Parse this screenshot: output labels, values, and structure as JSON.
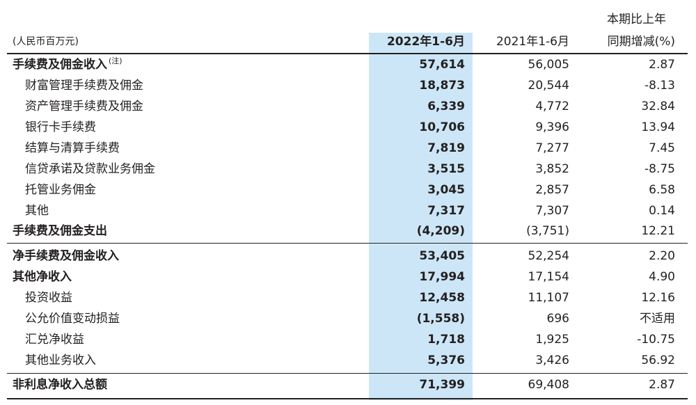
{
  "header": {
    "unit": "(人民币百万元)",
    "col1": "2022年1-6月",
    "col2": "2021年1-6月",
    "col3_line1": "本期比上年",
    "col3_line2": "同期增减(%)"
  },
  "rows": [
    {
      "label": "手续费及佣金收入",
      "note": "(注)",
      "v1": "57,614",
      "v2": "56,005",
      "v3": "2.87"
    },
    {
      "label": "财富管理手续费及佣金",
      "v1": "18,873",
      "v2": "20,544",
      "v3": "-8.13"
    },
    {
      "label": "资产管理手续费及佣金",
      "v1": "6,339",
      "v2": "4,772",
      "v3": "32.84"
    },
    {
      "label": "银行卡手续费",
      "v1": "10,706",
      "v2": "9,396",
      "v3": "13.94"
    },
    {
      "label": "结算与清算手续费",
      "v1": "7,819",
      "v2": "7,277",
      "v3": "7.45"
    },
    {
      "label": "信贷承诺及贷款业务佣金",
      "v1": "3,515",
      "v2": "3,852",
      "v3": "-8.75"
    },
    {
      "label": "托管业务佣金",
      "v1": "3,045",
      "v2": "2,857",
      "v3": "6.58"
    },
    {
      "label": "其他",
      "v1": "7,317",
      "v2": "7,307",
      "v3": "0.14"
    },
    {
      "label": "手续费及佣金支出",
      "v1": "(4,209)",
      "v2": "(3,751)",
      "v3": "12.21"
    },
    {
      "label": "净手续费及佣金收入",
      "v1": "53,405",
      "v2": "52,254",
      "v3": "2.20"
    },
    {
      "label": "其他净收入",
      "v1": "17,994",
      "v2": "17,154",
      "v3": "4.90"
    },
    {
      "label": "投资收益",
      "v1": "12,458",
      "v2": "11,107",
      "v3": "12.16"
    },
    {
      "label": "公允价值变动损益",
      "v1": "(1,558)",
      "v2": "696",
      "v3": "不适用"
    },
    {
      "label": "汇兑净收益",
      "v1": "1,718",
      "v2": "1,925",
      "v3": "-10.75"
    },
    {
      "label": "其他业务收入",
      "v1": "5,376",
      "v2": "3,426",
      "v3": "56.92"
    },
    {
      "label": "非利息净收入总额",
      "v1": "71,399",
      "v2": "69,408",
      "v3": "2.87"
    }
  ]
}
